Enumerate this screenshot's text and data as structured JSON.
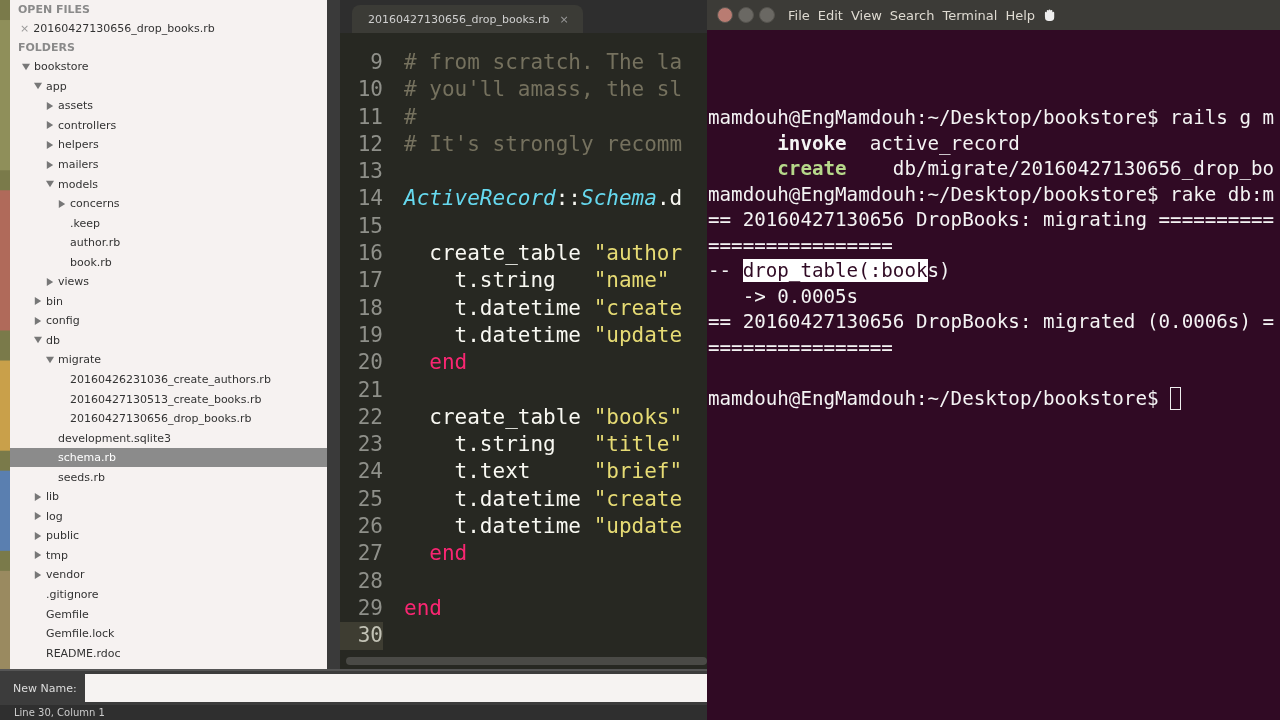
{
  "sidebar": {
    "open_files_heading": "OPEN FILES",
    "open_files": [
      {
        "close_glyph": "×",
        "name": "20160427130656_drop_books.rb"
      }
    ],
    "folders_heading": "FOLDERS",
    "tree": [
      {
        "kind": "folder",
        "label": "bookstore",
        "expanded": true,
        "selected": false,
        "children": [
          {
            "kind": "folder",
            "label": "app",
            "expanded": true,
            "selected": false,
            "children": [
              {
                "kind": "folder",
                "label": "assets",
                "expanded": false,
                "selected": false
              },
              {
                "kind": "folder",
                "label": "controllers",
                "expanded": false,
                "selected": false
              },
              {
                "kind": "folder",
                "label": "helpers",
                "expanded": false,
                "selected": false
              },
              {
                "kind": "folder",
                "label": "mailers",
                "expanded": false,
                "selected": false
              },
              {
                "kind": "folder",
                "label": "models",
                "expanded": true,
                "selected": false,
                "children": [
                  {
                    "kind": "folder",
                    "label": "concerns",
                    "expanded": false,
                    "selected": false
                  },
                  {
                    "kind": "file",
                    "label": ".keep",
                    "selected": false
                  },
                  {
                    "kind": "file",
                    "label": "author.rb",
                    "selected": false
                  },
                  {
                    "kind": "file",
                    "label": "book.rb",
                    "selected": false
                  }
                ]
              },
              {
                "kind": "folder",
                "label": "views",
                "expanded": false,
                "selected": false
              }
            ]
          },
          {
            "kind": "folder",
            "label": "bin",
            "expanded": false,
            "selected": false
          },
          {
            "kind": "folder",
            "label": "config",
            "expanded": false,
            "selected": false
          },
          {
            "kind": "folder",
            "label": "db",
            "expanded": true,
            "selected": false,
            "children": [
              {
                "kind": "folder",
                "label": "migrate",
                "expanded": true,
                "selected": false,
                "children": [
                  {
                    "kind": "file",
                    "label": "20160426231036_create_authors.rb",
                    "selected": false
                  },
                  {
                    "kind": "file",
                    "label": "20160427130513_create_books.rb",
                    "selected": false
                  },
                  {
                    "kind": "file",
                    "label": "20160427130656_drop_books.rb",
                    "selected": false
                  }
                ]
              },
              {
                "kind": "file",
                "label": "development.sqlite3",
                "selected": false
              },
              {
                "kind": "file",
                "label": "schema.rb",
                "selected": true
              },
              {
                "kind": "file",
                "label": "seeds.rb",
                "selected": false
              }
            ]
          },
          {
            "kind": "folder",
            "label": "lib",
            "expanded": false,
            "selected": false
          },
          {
            "kind": "folder",
            "label": "log",
            "expanded": false,
            "selected": false
          },
          {
            "kind": "folder",
            "label": "public",
            "expanded": false,
            "selected": false
          },
          {
            "kind": "folder",
            "label": "tmp",
            "expanded": false,
            "selected": false
          },
          {
            "kind": "folder",
            "label": "vendor",
            "expanded": false,
            "selected": false
          },
          {
            "kind": "file",
            "label": ".gitignore",
            "selected": false
          },
          {
            "kind": "file",
            "label": "Gemfile",
            "selected": false
          },
          {
            "kind": "file",
            "label": "Gemfile.lock",
            "selected": false
          },
          {
            "kind": "file",
            "label": "README.rdoc",
            "selected": false
          }
        ]
      }
    ]
  },
  "editor": {
    "tab": {
      "title": "20160427130656_drop_books.rb",
      "close_glyph": "×"
    },
    "lines": [
      {
        "number": "9",
        "highlighted": false,
        "tokens": [
          {
            "kind": "comment",
            "text": "# from scratch. The la"
          }
        ]
      },
      {
        "number": "10",
        "highlighted": false,
        "tokens": [
          {
            "kind": "comment",
            "text": "# you'll amass, the sl"
          }
        ]
      },
      {
        "number": "11",
        "highlighted": false,
        "tokens": [
          {
            "kind": "comment",
            "text": "#"
          }
        ]
      },
      {
        "number": "12",
        "highlighted": false,
        "tokens": [
          {
            "kind": "comment",
            "text": "# It's strongly recomm"
          }
        ]
      },
      {
        "number": "13",
        "highlighted": false
      },
      {
        "number": "14",
        "highlighted": false,
        "tokens": [
          {
            "kind": "constant",
            "text": "ActiveRecord"
          },
          {
            "kind": "plain",
            "text": "::"
          },
          {
            "kind": "constant",
            "text": "Schema"
          },
          {
            "kind": "plain",
            "text": ".d"
          }
        ]
      },
      {
        "number": "15",
        "highlighted": false
      },
      {
        "number": "16",
        "highlighted": false,
        "tokens": [
          {
            "kind": "plain",
            "text": "  create_table "
          },
          {
            "kind": "string",
            "text": "\"author"
          }
        ]
      },
      {
        "number": "17",
        "highlighted": false,
        "tokens": [
          {
            "kind": "plain",
            "text": "    t.string   "
          },
          {
            "kind": "string",
            "text": "\"name\""
          }
        ]
      },
      {
        "number": "18",
        "highlighted": false,
        "tokens": [
          {
            "kind": "plain",
            "text": "    t.datetime "
          },
          {
            "kind": "string",
            "text": "\"create"
          }
        ]
      },
      {
        "number": "19",
        "highlighted": false,
        "tokens": [
          {
            "kind": "plain",
            "text": "    t.datetime "
          },
          {
            "kind": "string",
            "text": "\"update"
          }
        ]
      },
      {
        "number": "20",
        "highlighted": false,
        "tokens": [
          {
            "kind": "keyword",
            "text": "  end"
          }
        ]
      },
      {
        "number": "21",
        "highlighted": false
      },
      {
        "number": "22",
        "highlighted": false,
        "tokens": [
          {
            "kind": "plain",
            "text": "  create_table "
          },
          {
            "kind": "string",
            "text": "\"books\""
          }
        ]
      },
      {
        "number": "23",
        "highlighted": false,
        "tokens": [
          {
            "kind": "plain",
            "text": "    t.string   "
          },
          {
            "kind": "string",
            "text": "\"title\""
          }
        ]
      },
      {
        "number": "24",
        "highlighted": false,
        "tokens": [
          {
            "kind": "plain",
            "text": "    t.text     "
          },
          {
            "kind": "string",
            "text": "\"brief\""
          }
        ]
      },
      {
        "number": "25",
        "highlighted": false,
        "tokens": [
          {
            "kind": "plain",
            "text": "    t.datetime "
          },
          {
            "kind": "string",
            "text": "\"create"
          }
        ]
      },
      {
        "number": "26",
        "highlighted": false,
        "tokens": [
          {
            "kind": "plain",
            "text": "    t.datetime "
          },
          {
            "kind": "string",
            "text": "\"update"
          }
        ]
      },
      {
        "number": "27",
        "highlighted": false,
        "tokens": [
          {
            "kind": "keyword",
            "text": "  end"
          }
        ]
      },
      {
        "number": "28",
        "highlighted": false
      },
      {
        "number": "29",
        "highlighted": false,
        "tokens": [
          {
            "kind": "keyword",
            "text": "end"
          }
        ]
      },
      {
        "number": "30",
        "highlighted": true
      }
    ]
  },
  "rename_bar": {
    "label": "New Name:"
  },
  "status_bar": {
    "text": "Line 30, Column 1"
  },
  "terminal": {
    "menu": [
      "File",
      "Edit",
      "View",
      "Search",
      "Terminal",
      "Help"
    ],
    "lines": [
      {
        "segments": [
          {
            "kind": "plain",
            "text": "mamdouh@EngMamdouh:~/Desktop/bookstore$ rails g m"
          }
        ]
      },
      {
        "segments": [
          {
            "kind": "bold",
            "text": "      invoke"
          },
          {
            "kind": "plain",
            "text": "  active_record"
          }
        ]
      },
      {
        "segments": [
          {
            "kind": "green",
            "text": "      create"
          },
          {
            "kind": "plain",
            "text": "    db/migrate/20160427130656_drop_bo"
          }
        ]
      },
      {
        "segments": [
          {
            "kind": "plain",
            "text": "mamdouh@EngMamdouh:~/Desktop/bookstore$ rake db:m"
          }
        ]
      },
      {
        "segments": [
          {
            "kind": "plain",
            "text": "== 20160427130656 DropBooks: migrating =========="
          }
        ]
      },
      {
        "segments": [
          {
            "kind": "plain",
            "text": "================"
          }
        ]
      },
      {
        "segments": [
          {
            "kind": "plain",
            "text": "-- "
          },
          {
            "kind": "selected",
            "text": "drop_table(:book"
          },
          {
            "kind": "plain",
            "text": "s)"
          }
        ]
      },
      {
        "segments": [
          {
            "kind": "plain",
            "text": "   -> 0.0005s"
          }
        ]
      },
      {
        "segments": [
          {
            "kind": "plain",
            "text": "== 20160427130656 DropBooks: migrated (0.0006s) ="
          }
        ]
      },
      {
        "segments": [
          {
            "kind": "plain",
            "text": "================"
          }
        ]
      },
      {
        "blank_line_before": true,
        "segments": [
          {
            "kind": "plain",
            "text": "mamdouh@EngMamdouh:~/Desktop/bookstore$ "
          }
        ],
        "cursor": true
      }
    ]
  }
}
